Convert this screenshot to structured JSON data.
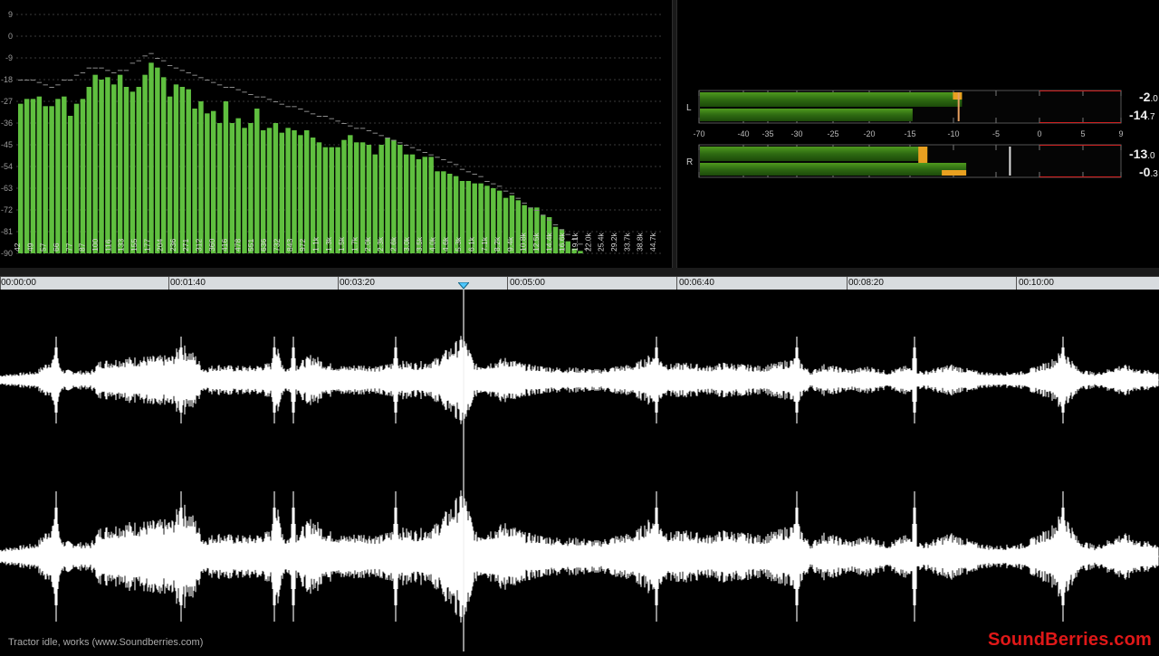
{
  "spectrum": {
    "db_labels": [
      "9",
      "0",
      "-9",
      "-18",
      "-27",
      "-36",
      "-45",
      "-54",
      "-63",
      "-72",
      "-81",
      "-90"
    ],
    "freq_labels": [
      "42",
      "49",
      "57",
      "66",
      "77",
      "87",
      "100",
      "116",
      "133",
      "155",
      "177",
      "204",
      "236",
      "271",
      "312",
      "360",
      "416",
      "478",
      "551",
      "636",
      "732",
      "843",
      "972",
      "1.1k",
      "1.3k",
      "1.5k",
      "1.7k",
      "2.0k",
      "2.3k",
      "2.6k",
      "3.0k",
      "3.5k",
      "4.0k",
      "4.6k",
      "5.3k",
      "6.1k",
      "7.1k",
      "8.2k",
      "9.4k",
      "10.8k",
      "12.5k",
      "14.4k",
      "16.6k",
      "19.1k",
      "22.0k",
      "25.4k",
      "29.2k",
      "33.7k",
      "38.8k",
      "44.7k"
    ],
    "bar_color": "#5fbf3f",
    "levels_db": [
      -28,
      -26,
      -26,
      -25,
      -29,
      -29,
      -26,
      -25,
      -33,
      -28,
      -26,
      -21,
      -16,
      -18,
      -17,
      -20,
      -16,
      -21,
      -23,
      -21,
      -16,
      -11,
      -13,
      -17,
      -25,
      -20,
      -21,
      -22,
      -30,
      -27,
      -32,
      -31,
      -36,
      -27,
      -36,
      -34,
      -38,
      -36,
      -30,
      -39,
      -38,
      -36,
      -40,
      -38,
      -39,
      -41,
      -39,
      -42,
      -44,
      -46,
      -46,
      -46,
      -43,
      -41,
      -44,
      -44,
      -45,
      -49,
      -45,
      -42,
      -43,
      -45,
      -49,
      -49,
      -51,
      -50,
      -50,
      -56,
      -56,
      -57,
      -58,
      -60,
      -60,
      -61,
      -61,
      -62,
      -63,
      -64,
      -67,
      -66,
      -68,
      -70,
      -71,
      -71,
      -74,
      -75,
      -79,
      -80,
      -85,
      -88,
      -89,
      -90
    ],
    "peaks_db": [
      -18,
      -18,
      -18,
      -19,
      -20,
      -21,
      -20,
      -18,
      -18,
      -16,
      -15,
      -13,
      -13,
      -13,
      -14,
      -15,
      -14,
      -14,
      -11,
      -10,
      -8,
      -7,
      -9,
      -10,
      -12,
      -13,
      -14,
      -15,
      -16,
      -17,
      -18,
      -19,
      -20,
      -21,
      -21,
      -22,
      -23,
      -24,
      -25,
      -25,
      -26,
      -27,
      -28,
      -29,
      -29,
      -30,
      -31,
      -32,
      -33,
      -33,
      -34,
      -35,
      -36,
      -37,
      -38,
      -38,
      -39,
      -40,
      -41,
      -42,
      -43,
      -44,
      -45,
      -46,
      -47,
      -48,
      -49,
      -50,
      -51,
      -52,
      -53,
      -55,
      -56,
      -57,
      -58,
      -60,
      -61,
      -62,
      -64,
      -65,
      -67,
      -69,
      -71,
      -72,
      -74,
      -76,
      -78,
      -80,
      -82,
      -84,
      -86,
      -88
    ]
  },
  "meters": {
    "scale_labels": [
      "-70",
      "-40",
      "-35",
      "-30",
      "-25",
      "-20",
      "-15",
      "-10",
      "-5",
      "0",
      "5",
      "9"
    ],
    "channels": [
      {
        "label": "L",
        "peak_int": "-2",
        "peak_dec": ".0",
        "rms_int": "-14",
        "rms_dec": ".7",
        "peak_db": -2.0,
        "rms_db": -14.7,
        "hold_db": -9.5,
        "upper_level_db": -9.0,
        "lower_level_db": -14.7
      },
      {
        "label": "R",
        "peak_int": "-13",
        "peak_dec": ".0",
        "rms_int": "-0",
        "rms_dec": ".3",
        "peak_db": -13.0,
        "rms_db": -0.3,
        "hold_db": -3.5,
        "upper_level_db": -13.0,
        "lower_level_db": -8.5
      }
    ]
  },
  "timeline": {
    "labels": [
      "00:00:00",
      "00:01:40",
      "00:03:20",
      "00:05:00",
      "00:06:40",
      "00:08:20",
      "00:10:00"
    ],
    "playhead_fraction": 0.4
  },
  "status": {
    "caption": "Tractor idle, works  (www.Soundberries.com)",
    "brand": "SoundBerries.com"
  }
}
